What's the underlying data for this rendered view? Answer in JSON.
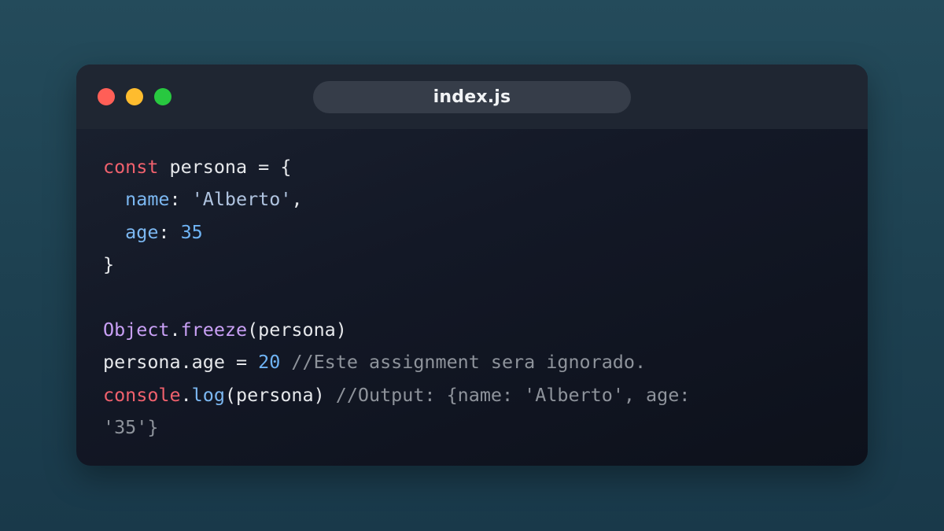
{
  "window": {
    "title": "index.js",
    "colors": {
      "close": "#ff5f57",
      "minimize": "#febc2e",
      "zoom": "#28c840"
    }
  },
  "code": {
    "lines": [
      [
        {
          "text": "const",
          "type": "keyword"
        },
        {
          "text": " persona = {",
          "type": "plain"
        }
      ],
      [
        {
          "text": "  ",
          "type": "plain"
        },
        {
          "text": "name",
          "type": "property"
        },
        {
          "text": ": ",
          "type": "plain"
        },
        {
          "text": "'Alberto'",
          "type": "string"
        },
        {
          "text": ",",
          "type": "plain"
        }
      ],
      [
        {
          "text": "  ",
          "type": "plain"
        },
        {
          "text": "age",
          "type": "property"
        },
        {
          "text": ": ",
          "type": "plain"
        },
        {
          "text": "35",
          "type": "number"
        }
      ],
      [
        {
          "text": "}",
          "type": "plain"
        }
      ],
      [],
      [
        {
          "text": "Object",
          "type": "object"
        },
        {
          "text": ".",
          "type": "plain"
        },
        {
          "text": "freeze",
          "type": "object"
        },
        {
          "text": "(persona)",
          "type": "plain"
        }
      ],
      [
        {
          "text": "persona.age = ",
          "type": "plain"
        },
        {
          "text": "20",
          "type": "number"
        },
        {
          "text": " //Este assignment sera ignorado.",
          "type": "comment"
        }
      ],
      [
        {
          "text": "console",
          "type": "keyword"
        },
        {
          "text": ".",
          "type": "plain"
        },
        {
          "text": "log",
          "type": "function"
        },
        {
          "text": "(persona)",
          "type": "plain"
        },
        {
          "text": " //Output: {name: 'Alberto', age:",
          "type": "comment"
        }
      ],
      [
        {
          "text": "'35'}",
          "type": "comment"
        }
      ]
    ]
  }
}
